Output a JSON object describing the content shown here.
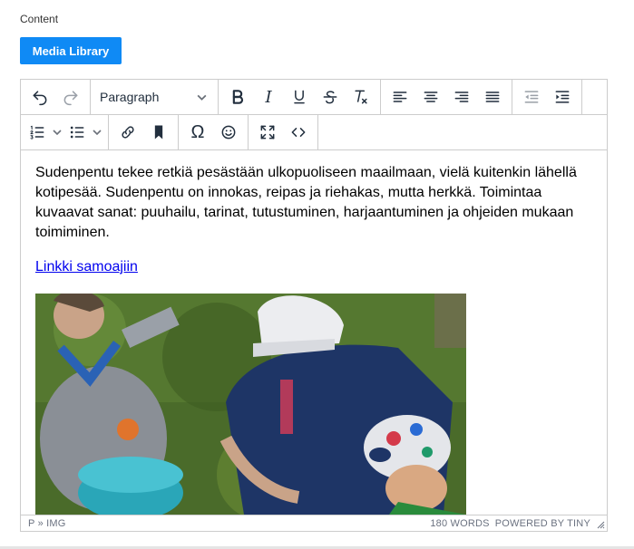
{
  "field": {
    "label": "Content"
  },
  "media_button": {
    "label": "Media Library"
  },
  "toolbar": {
    "block_format": "Paragraph",
    "row1_icons": [
      "undo-icon",
      "redo-icon",
      "bold-icon",
      "italic-icon",
      "underline-icon",
      "strikethrough-icon",
      "clear-formatting-icon",
      "align-left-icon",
      "align-center-icon",
      "align-right-icon",
      "justify-icon",
      "outdent-icon",
      "indent-icon"
    ],
    "row2_icons": [
      "numbered-list-icon",
      "bullet-list-icon",
      "link-icon",
      "bookmark-icon",
      "omega-icon",
      "emoji-icon",
      "fullscreen-icon",
      "code-icon"
    ],
    "italic_glyph": "I",
    "underline_glyph": "U",
    "strike_glyph": "S",
    "omega_glyph": "Ω"
  },
  "content": {
    "paragraph": "Sudenpentu tekee retkiä pesästään ulkopuoliseen maailmaan, vielä kuitenkin lähellä kotipesää. Sudenpentu on innokas, reipas ja riehakas, mutta herkkä. Toimintaa kuvaavat sanat: puuhailu, tarinat, tutustuminen, harjaantuminen ja ohjeiden mukaan toimiminen.",
    "link_text": "Linkki samoajiin"
  },
  "statusbar": {
    "path": "P » IMG",
    "word_count": "180 WORDS",
    "powered_by": "POWERED BY TINY"
  },
  "colors": {
    "accent": "#0f8af5",
    "link": "#0000ee",
    "border": "#cccccc"
  }
}
